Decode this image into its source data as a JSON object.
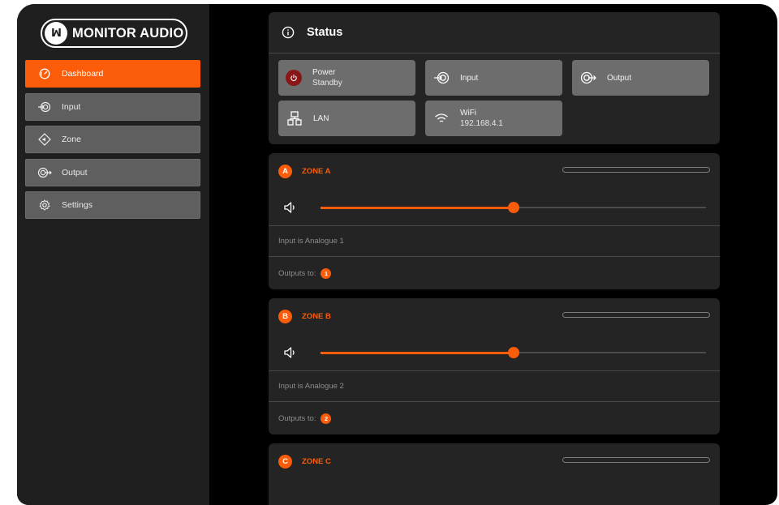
{
  "brand": {
    "logo_text": "MONITOR AUDIO",
    "accent": "#fb5c0a"
  },
  "sidebar": {
    "items": [
      {
        "label": "Dashboard",
        "icon": "dashboard-gauge-icon",
        "active": true
      },
      {
        "label": "Input",
        "icon": "input-icon",
        "active": false
      },
      {
        "label": "Zone",
        "icon": "zone-speaker-icon",
        "active": false
      },
      {
        "label": "Output",
        "icon": "output-icon",
        "active": false
      },
      {
        "label": "Settings",
        "icon": "gear-icon",
        "active": false
      }
    ]
  },
  "status": {
    "title": "Status",
    "tiles": {
      "power": {
        "label": "Power",
        "value": "Standby"
      },
      "input": {
        "label": "Input"
      },
      "output": {
        "label": "Output"
      },
      "lan": {
        "label": "LAN"
      },
      "wifi": {
        "label": "WiFi",
        "value": "192.168.4.1"
      }
    }
  },
  "zones": [
    {
      "badge": "A",
      "title": "ZONE A",
      "volume_fraction": 0.5,
      "input_text": "Input is Analogue 1",
      "outputs_label": "Outputs to:",
      "output_badge": "1"
    },
    {
      "badge": "B",
      "title": "ZONE B",
      "volume_fraction": 0.5,
      "input_text": "Input is Analogue 2",
      "outputs_label": "Outputs to:",
      "output_badge": "2"
    },
    {
      "badge": "C",
      "title": "ZONE C"
    }
  ]
}
